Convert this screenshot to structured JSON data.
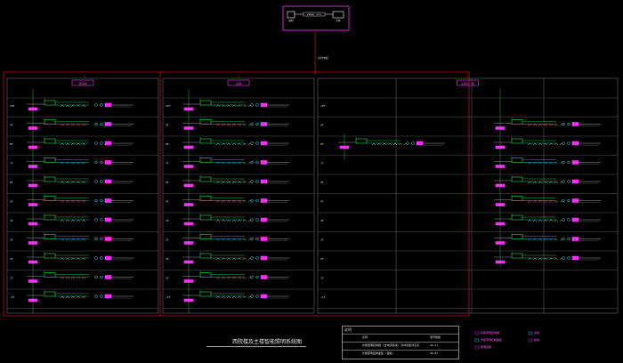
{
  "diagram": {
    "title": "西院楼及主楼智能照明系统图",
    "top_label": "总线电缆",
    "server_box": {
      "left_label": "照明",
      "mid_label": "ETHERNET TCP/IP",
      "right_label": "主机"
    },
    "panels": [
      {
        "label": "西院楼"
      },
      {
        "label": "主楼"
      },
      {
        "label": "主楼负一层"
      }
    ],
    "floors_left": [
      "10F",
      "9F",
      "8F",
      "7F",
      "6F",
      "5F",
      "4F",
      "3F",
      "2F",
      "1F",
      "-1F"
    ],
    "notes": {
      "header": "说明",
      "columns": [
        "名称",
        "型号规格"
      ],
      "rows": [
        {
          "name": "智能照明控制器 (含电源模块) 具体选型详见表",
          "model": "SW-A1"
        },
        {
          "name": "智能照明控制面板 (面板)",
          "model": "SW-B1"
        }
      ]
    },
    "legend": [
      "智能照明控制器",
      "智能照明控制面板",
      "照明回路",
      "总线",
      "模块"
    ],
    "colors": {
      "frame": "#c0101c",
      "magenta": "#ff2cff",
      "green": "#2fe04a",
      "cyan": "#28e4ff",
      "yellow": "#e8e83a",
      "grid": "#555555"
    }
  }
}
